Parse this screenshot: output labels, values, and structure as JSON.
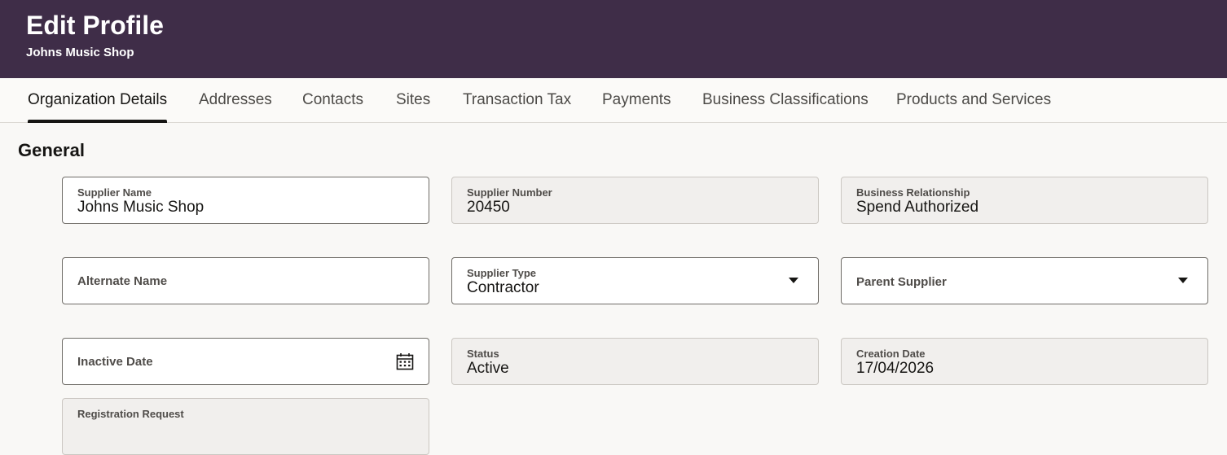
{
  "header": {
    "title": "Edit Profile",
    "subtitle": "Johns Music Shop"
  },
  "tabs": [
    {
      "label": "Organization Details",
      "active": true
    },
    {
      "label": "Addresses"
    },
    {
      "label": "Contacts"
    },
    {
      "label": "Sites"
    },
    {
      "label": "Transaction Tax"
    },
    {
      "label": "Payments"
    },
    {
      "label": "Business Classifications"
    },
    {
      "label": "Products and Services"
    }
  ],
  "section": {
    "title": "General"
  },
  "fields": {
    "supplier_name": {
      "label": "Supplier Name",
      "value": "Johns Music Shop"
    },
    "supplier_number": {
      "label": "Supplier Number",
      "value": "20450"
    },
    "business_relationship": {
      "label": "Business Relationship",
      "value": "Spend Authorized"
    },
    "alternate_name": {
      "label": "Alternate Name",
      "value": ""
    },
    "supplier_type": {
      "label": "Supplier Type",
      "value": "Contractor"
    },
    "parent_supplier": {
      "label": "Parent Supplier",
      "value": ""
    },
    "inactive_date": {
      "label": "Inactive Date",
      "value": ""
    },
    "status": {
      "label": "Status",
      "value": "Active"
    },
    "creation_date": {
      "label": "Creation Date",
      "value": "17/04/2026"
    },
    "registration_request": {
      "label": "Registration Request",
      "value": ""
    }
  },
  "icons": {
    "dropdown": "chevron-down-icon",
    "calendar": "calendar-icon"
  },
  "colors": {
    "header_bg": "#3f2d48",
    "page_bg": "#f9f8f6",
    "active_tab_indicator": "#161513"
  }
}
